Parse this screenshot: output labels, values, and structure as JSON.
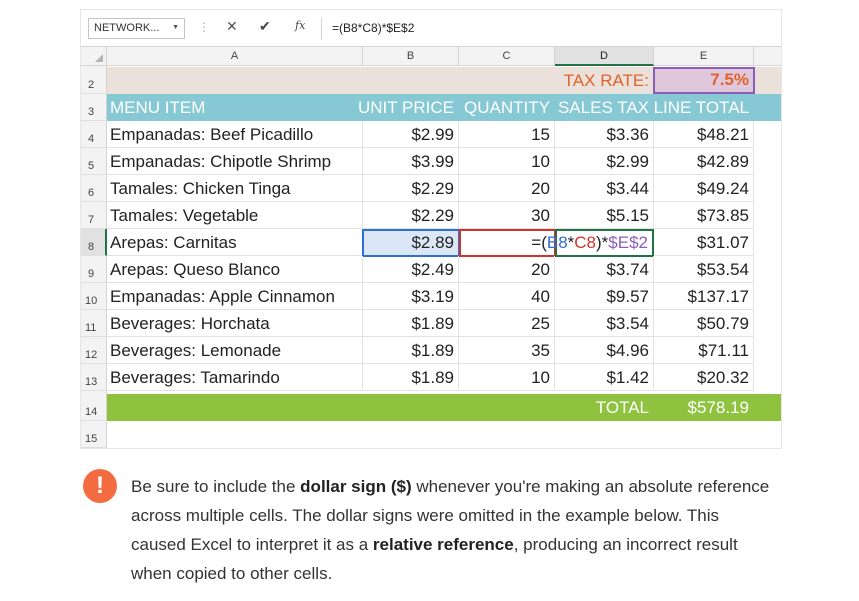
{
  "formula_bar": {
    "name_box": "NETWORK...",
    "cancel": "✕",
    "enter": "✔",
    "fx": "fx",
    "formula": "=(B8*C8)*$E$2"
  },
  "columns": [
    "A",
    "B",
    "C",
    "D",
    "E"
  ],
  "rows": {
    "r2": {
      "num": "2",
      "d": "TAX RATE:",
      "e": "7.5%"
    },
    "r3": {
      "num": "3",
      "a": "MENU ITEM",
      "b": "UNIT PRICE",
      "c": "QUANTITY",
      "d": "SALES TAX",
      "e": "LINE TOTAL"
    },
    "items": [
      {
        "num": "4",
        "a": "Empanadas: Beef Picadillo",
        "b": "$2.99",
        "c": "15",
        "d": "$3.36",
        "e": "$48.21"
      },
      {
        "num": "5",
        "a": "Empanadas: Chipotle Shrimp",
        "b": "$3.99",
        "c": "10",
        "d": "$2.99",
        "e": "$42.89"
      },
      {
        "num": "6",
        "a": "Tamales: Chicken Tinga",
        "b": "$2.29",
        "c": "20",
        "d": "$3.44",
        "e": "$49.24"
      },
      {
        "num": "7",
        "a": "Tamales: Vegetable",
        "b": "$2.29",
        "c": "30",
        "d": "$5.15",
        "e": "$73.85"
      },
      {
        "num": "8",
        "a": "Arepas: Carnitas",
        "b": "$2.89",
        "c": "",
        "d": "",
        "e": "$31.07"
      },
      {
        "num": "9",
        "a": "Arepas: Queso Blanco",
        "b": "$2.49",
        "c": "20",
        "d": "$3.74",
        "e": "$53.54"
      },
      {
        "num": "10",
        "a": "Empanadas: Apple Cinnamon",
        "b": "$3.19",
        "c": "40",
        "d": "$9.57",
        "e": "$137.17"
      },
      {
        "num": "11",
        "a": "Beverages: Horchata",
        "b": "$1.89",
        "c": "25",
        "d": "$3.54",
        "e": "$50.79"
      },
      {
        "num": "12",
        "a": "Beverages: Lemonade",
        "b": "$1.89",
        "c": "35",
        "d": "$4.96",
        "e": "$71.11"
      },
      {
        "num": "13",
        "a": "Beverages: Tamarindo",
        "b": "$1.89",
        "c": "10",
        "d": "$1.42",
        "e": "$20.32"
      }
    ],
    "r14": {
      "num": "14",
      "d": "TOTAL",
      "e": "$578.19"
    },
    "r15": {
      "num": "15"
    }
  },
  "editing_formula": {
    "p1": "=(",
    "ref1": "B8",
    "op1": "*",
    "ref2": "C8",
    "p2": ")*",
    "ref3": "$E$2"
  },
  "ref_colors": {
    "b8": "#2f6fd1",
    "c8": "#d0342c",
    "e2": "#8b5db8"
  },
  "colors": {
    "header_band": "#86c9d4",
    "tax_band": "#eae1db",
    "total_band": "#8ec23f",
    "tax_label": "#e3622b",
    "callout": "#f26b41"
  },
  "note": {
    "icon": "exclamation-icon",
    "t1": "Be sure to include the ",
    "b1": "dollar sign ($)",
    "t2": " whenever you're making an absolute reference across multiple cells. The dollar signs were omitted in the example below. This caused Excel to interpret it as a ",
    "b2": "relative reference",
    "t3": ", producing an incorrect result when copied to other cells."
  }
}
